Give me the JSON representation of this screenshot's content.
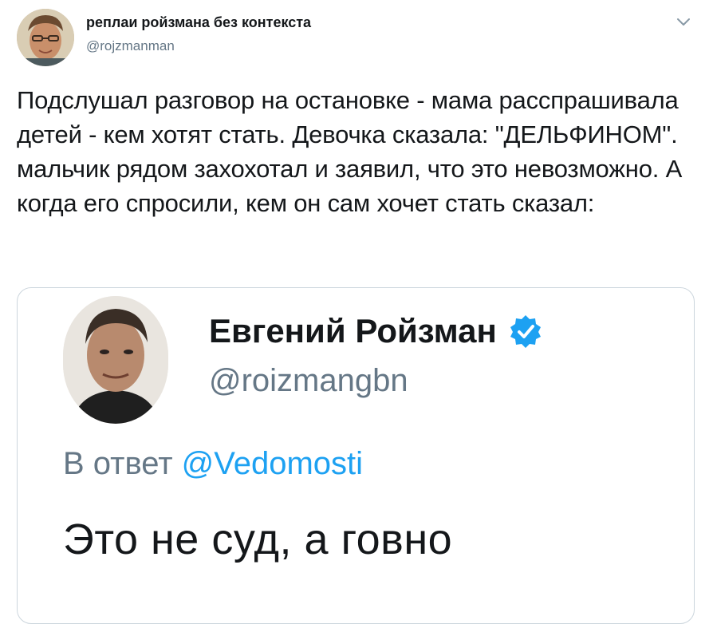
{
  "tweet": {
    "author_name": "реплаи ройзмана без контекста",
    "author_handle": "@rojzmanman",
    "text": "Подслушал разговор на остановке - мама расспрашивала детей - кем хотят стать. Девочка сказала: \"ДЕЛЬФИНОМ\". мальчик рядом захохотал и заявил, что это невозможно. А когда его спросили, кем он сам хочет стать сказал:"
  },
  "embedded": {
    "author_name": "Евгений Ройзман",
    "author_handle": "@roizmangbn",
    "reply_prefix": "В ответ",
    "reply_mention": "@Vedomosti",
    "text": "Это не суд, а говно"
  },
  "colors": {
    "text": "#14171a",
    "secondary": "#657786",
    "link": "#1da1f2",
    "border": "#ccd6dd"
  },
  "icons": {
    "caret": "chevron-down-icon",
    "verified": "verified-badge-icon"
  }
}
